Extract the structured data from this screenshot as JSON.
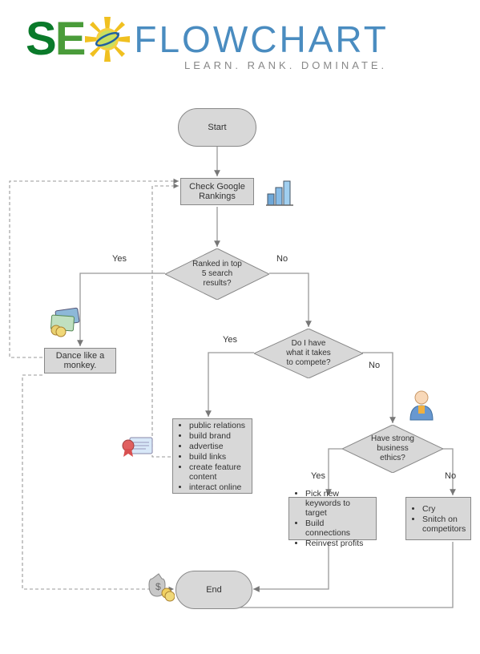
{
  "brand": {
    "seo_s": "S",
    "seo_e": "E",
    "flowchart": "FLOWCHART",
    "tagline": "LEARN. RANK. DOMINATE."
  },
  "nodes": {
    "start": "Start",
    "check_rankings": "Check Google\nRankings",
    "ranked_top5": "Ranked in top\n5 search\nresults?",
    "dance_monkey": "Dance like a\nmonkey.",
    "have_what_takes": "Do I have\nwhat it takes\nto compete?",
    "strong_ethics": "Have strong\nbusiness\nethics?",
    "end": "End"
  },
  "lists": {
    "compete_yes": [
      "public relations",
      "build brand",
      "advertise",
      "build links",
      "create feature content",
      "interact online"
    ],
    "ethics_yes": [
      "Pick new keywords to target",
      "Build connections",
      "Reinvest profits"
    ],
    "ethics_no": [
      "Cry",
      "Snitch on competitors"
    ]
  },
  "labels": {
    "yes1": "Yes",
    "no1": "No",
    "yes2": "Yes",
    "no2": "No",
    "yes3": "Yes",
    "no3": "No"
  },
  "icons": {
    "sun": "sun-icon",
    "chart": "bar-chart-icon",
    "money_card": "money-card-icon",
    "ribbon": "ribbon-certificate-icon",
    "person": "person-icon",
    "money_bag": "money-bag-icon"
  }
}
